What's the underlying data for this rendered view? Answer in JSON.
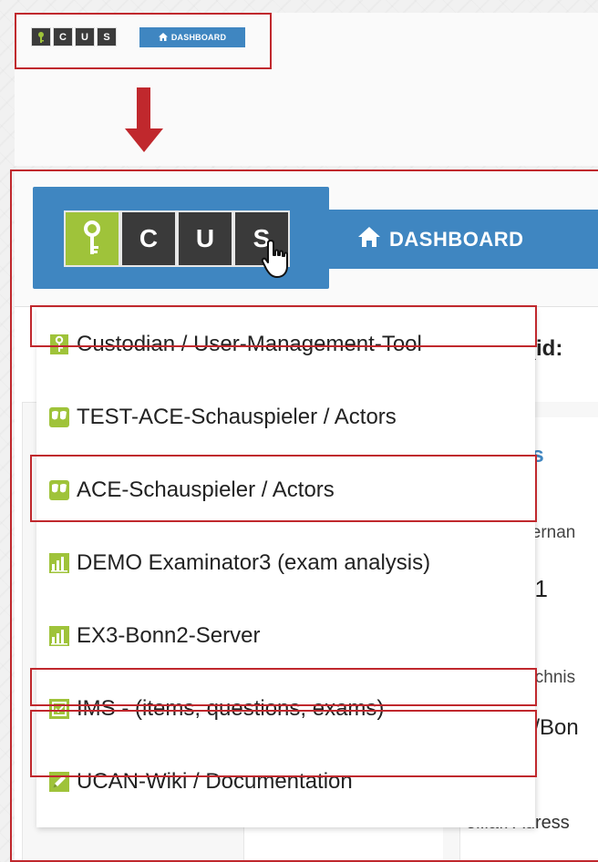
{
  "colors": {
    "accent_blue": "#3f86c1",
    "logo_green": "#9fc33a",
    "logo_dark": "#3a3a3a",
    "highlight_red": "#c0282d"
  },
  "small_header": {
    "logo_letters": [
      "C",
      "U",
      "S"
    ],
    "dashboard_label": "DASHBOARD"
  },
  "large_header": {
    "logo_letters": [
      "C",
      "U",
      "S"
    ],
    "dashboard_label": "DASHBOARD"
  },
  "background": {
    "title_fragment": "1 (id:",
    "section_fragment": "ils",
    "label_username_fragment": "tzernan",
    "value_username_fragment": "n1",
    "label_directory_fragment": "eichnis",
    "value_directory_fragment": "n/Bon",
    "label_email_fragment": "eмaıı Adress"
  },
  "menu": {
    "items": [
      {
        "label": "Custodian / User-Management-Tool",
        "icon": "custodian-key-icon"
      },
      {
        "label": "TEST-ACE-Schauspieler / Actors",
        "icon": "masks-icon"
      },
      {
        "label": "ACE-Schauspieler / Actors",
        "icon": "masks-icon"
      },
      {
        "label": "DEMO Examinator3 (exam analysis)",
        "icon": "bar-chart-icon"
      },
      {
        "label": "EX3-Bonn2-Server",
        "icon": "bar-chart-icon"
      },
      {
        "label": "IMS - (items, questions, exams)",
        "icon": "checkbox-icon"
      },
      {
        "label": "UCAN-Wiki / Documentation",
        "icon": "pencil-icon"
      }
    ]
  }
}
